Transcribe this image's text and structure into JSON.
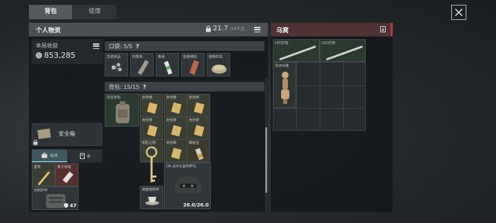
{
  "tabs": [
    {
      "label": "背包"
    },
    {
      "label": "健康"
    }
  ],
  "left": {
    "title": "个人物资",
    "weight": {
      "value": "21.7",
      "capacity": "/74千克"
    },
    "income": {
      "label": "本局收获",
      "value": "853,285"
    },
    "pocket": {
      "label": "口袋:",
      "count": "5/5",
      "help": "?"
    },
    "pocket_items": [
      {
        "label": "急救用品"
      },
      {
        "label": "肉香条"
      },
      {
        "label": "鼻通"
      },
      {
        "label": "能量棒能"
      },
      {
        "label": "植物样本"
      }
    ],
    "backpack": {
      "label": "背包:",
      "count": "15/15",
      "help": "?"
    },
    "backpack_main_label": "突击背包",
    "id_cards": [
      {
        "label": "身份牌"
      },
      {
        "label": "身份牌"
      },
      {
        "label": "身份牌"
      },
      {
        "label": "身份牌"
      },
      {
        "label": "身份牌"
      },
      {
        "label": "身份牌"
      },
      {
        "label": "身份牌"
      },
      {
        "label": "身份牌"
      }
    ],
    "key_label": "钥匙之钥",
    "bullet_label": "藏秘宝",
    "helmet_label": "DB 战术头盔阿萨拉",
    "helmet_value": "26.0/26.0",
    "cup_label": "典雅咖啡杯",
    "safe_label": "安全箱",
    "count_tabs": [
      {
        "value": "4/4"
      },
      {
        "value": "4"
      }
    ],
    "safe_items": [
      {
        "label": "金笔"
      },
      {
        "label": "量子存储"
      },
      {
        "label": "自制护甲"
      }
    ],
    "armor_value": "47"
  },
  "right": {
    "title": "乌窝",
    "items": [
      {
        "label": "LED灯管"
      },
      {
        "label": "LED灯管"
      },
      {
        "label": "非洲木雕"
      }
    ]
  },
  "colors": {
    "accent_red": "#b83a34",
    "gold_item": "#d8b66a"
  }
}
